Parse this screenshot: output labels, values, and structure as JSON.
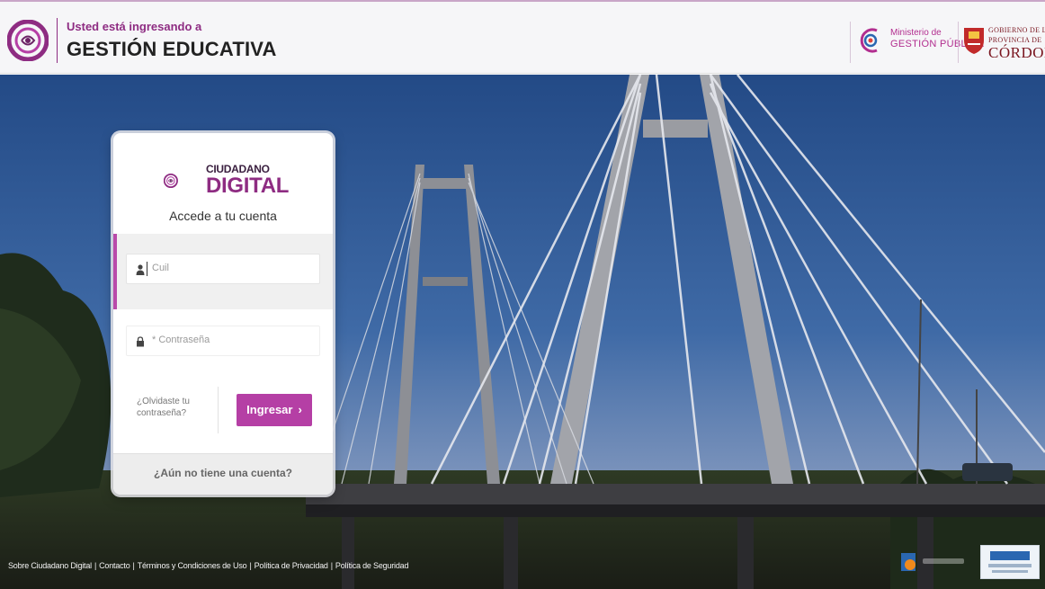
{
  "header": {
    "subtitle": "Usted está ingresando a",
    "title": "GESTIÓN EDUCATIVA",
    "ministerio_line1": "Ministerio de",
    "ministerio_line2": "GESTIÓN PÚBLICA",
    "gobierno_line1": "GOBIERNO DE LA",
    "gobierno_line2": "PROVINCIA DE",
    "gobierno_line3": "CÓRDOBA"
  },
  "login": {
    "brand_small": "CIUDADANO",
    "brand_big": "DIGITAL",
    "subtitle": "Accede a tu cuenta",
    "user_placeholder": "Cuil",
    "password_placeholder": "* Contraseña",
    "forgot_line1": "¿Olvidaste tu",
    "forgot_line2": "contraseña?",
    "submit_label": "Ingresar",
    "submit_chevron": "›",
    "no_account": "¿Aún no tiene una cuenta?"
  },
  "footer": {
    "links": [
      "Sobre Ciudadano Digital",
      "Contacto",
      "Términos y Condiciones de Uso",
      "Política de Privacidad",
      "Política de Seguridad"
    ],
    "separator": "|"
  },
  "colors": {
    "brand": "#8e2c82",
    "button": "#b53fa5",
    "accent_bar": "#b94aaa"
  },
  "icons": {
    "user": "user-icon",
    "lock": "lock-icon"
  }
}
